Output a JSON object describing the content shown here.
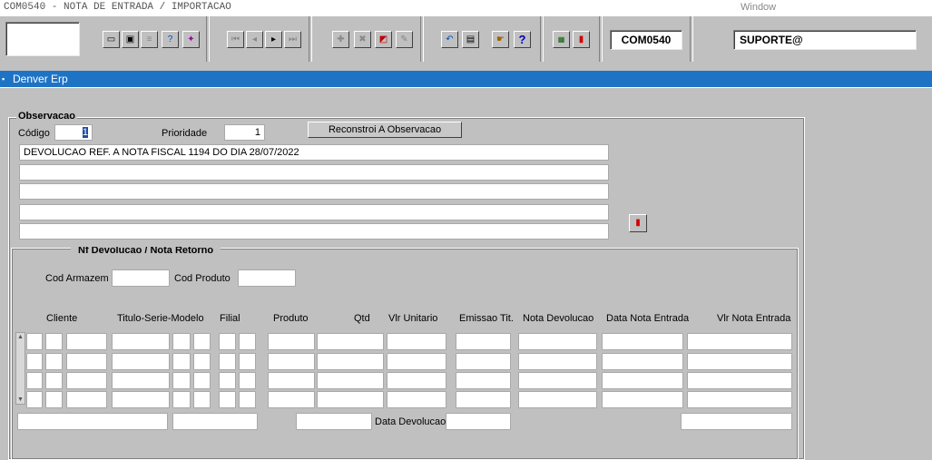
{
  "window": {
    "title": "COM0540 - NOTA DE ENTRADA / IMPORTACAO",
    "menu": "Window"
  },
  "toolbar": {
    "form_code": "COM0540",
    "user": "SUPORTE@"
  },
  "app": {
    "title": "Denver Erp"
  },
  "observacao": {
    "section_label": "Observacao",
    "codigo_label": "Código",
    "codigo_value": "1",
    "prioridade_label": "Prioridade",
    "prioridade_value": "1",
    "reconstroi_label": "Reconstroi A Observacao",
    "lines": [
      "DEVOLUCAO REF. A NOTA FISCAL 1194 DO DIA 28/07/2022",
      "",
      "",
      "",
      ""
    ]
  },
  "nf": {
    "section_label": "Nf Devolucao / Nota Retorno",
    "cod_armazem_label": "Cod Armazem",
    "cod_produto_label": "Cod Produto",
    "columns": {
      "cliente": "Cliente",
      "titulo": "Titulo-Serie-Modelo",
      "filial": "Filial",
      "produto": "Produto",
      "qtd": "Qtd",
      "vlr_unitario": "Vlr Unitario",
      "emissao": "Emissao Tit.",
      "nota_devolucao": "Nota Devolucao",
      "data_nota_entrada": "Data Nota Entrada",
      "vlr_nota_entrada": "Vlr Nota Entrada"
    },
    "data_devolucao_label": "Data Devolucao"
  }
}
